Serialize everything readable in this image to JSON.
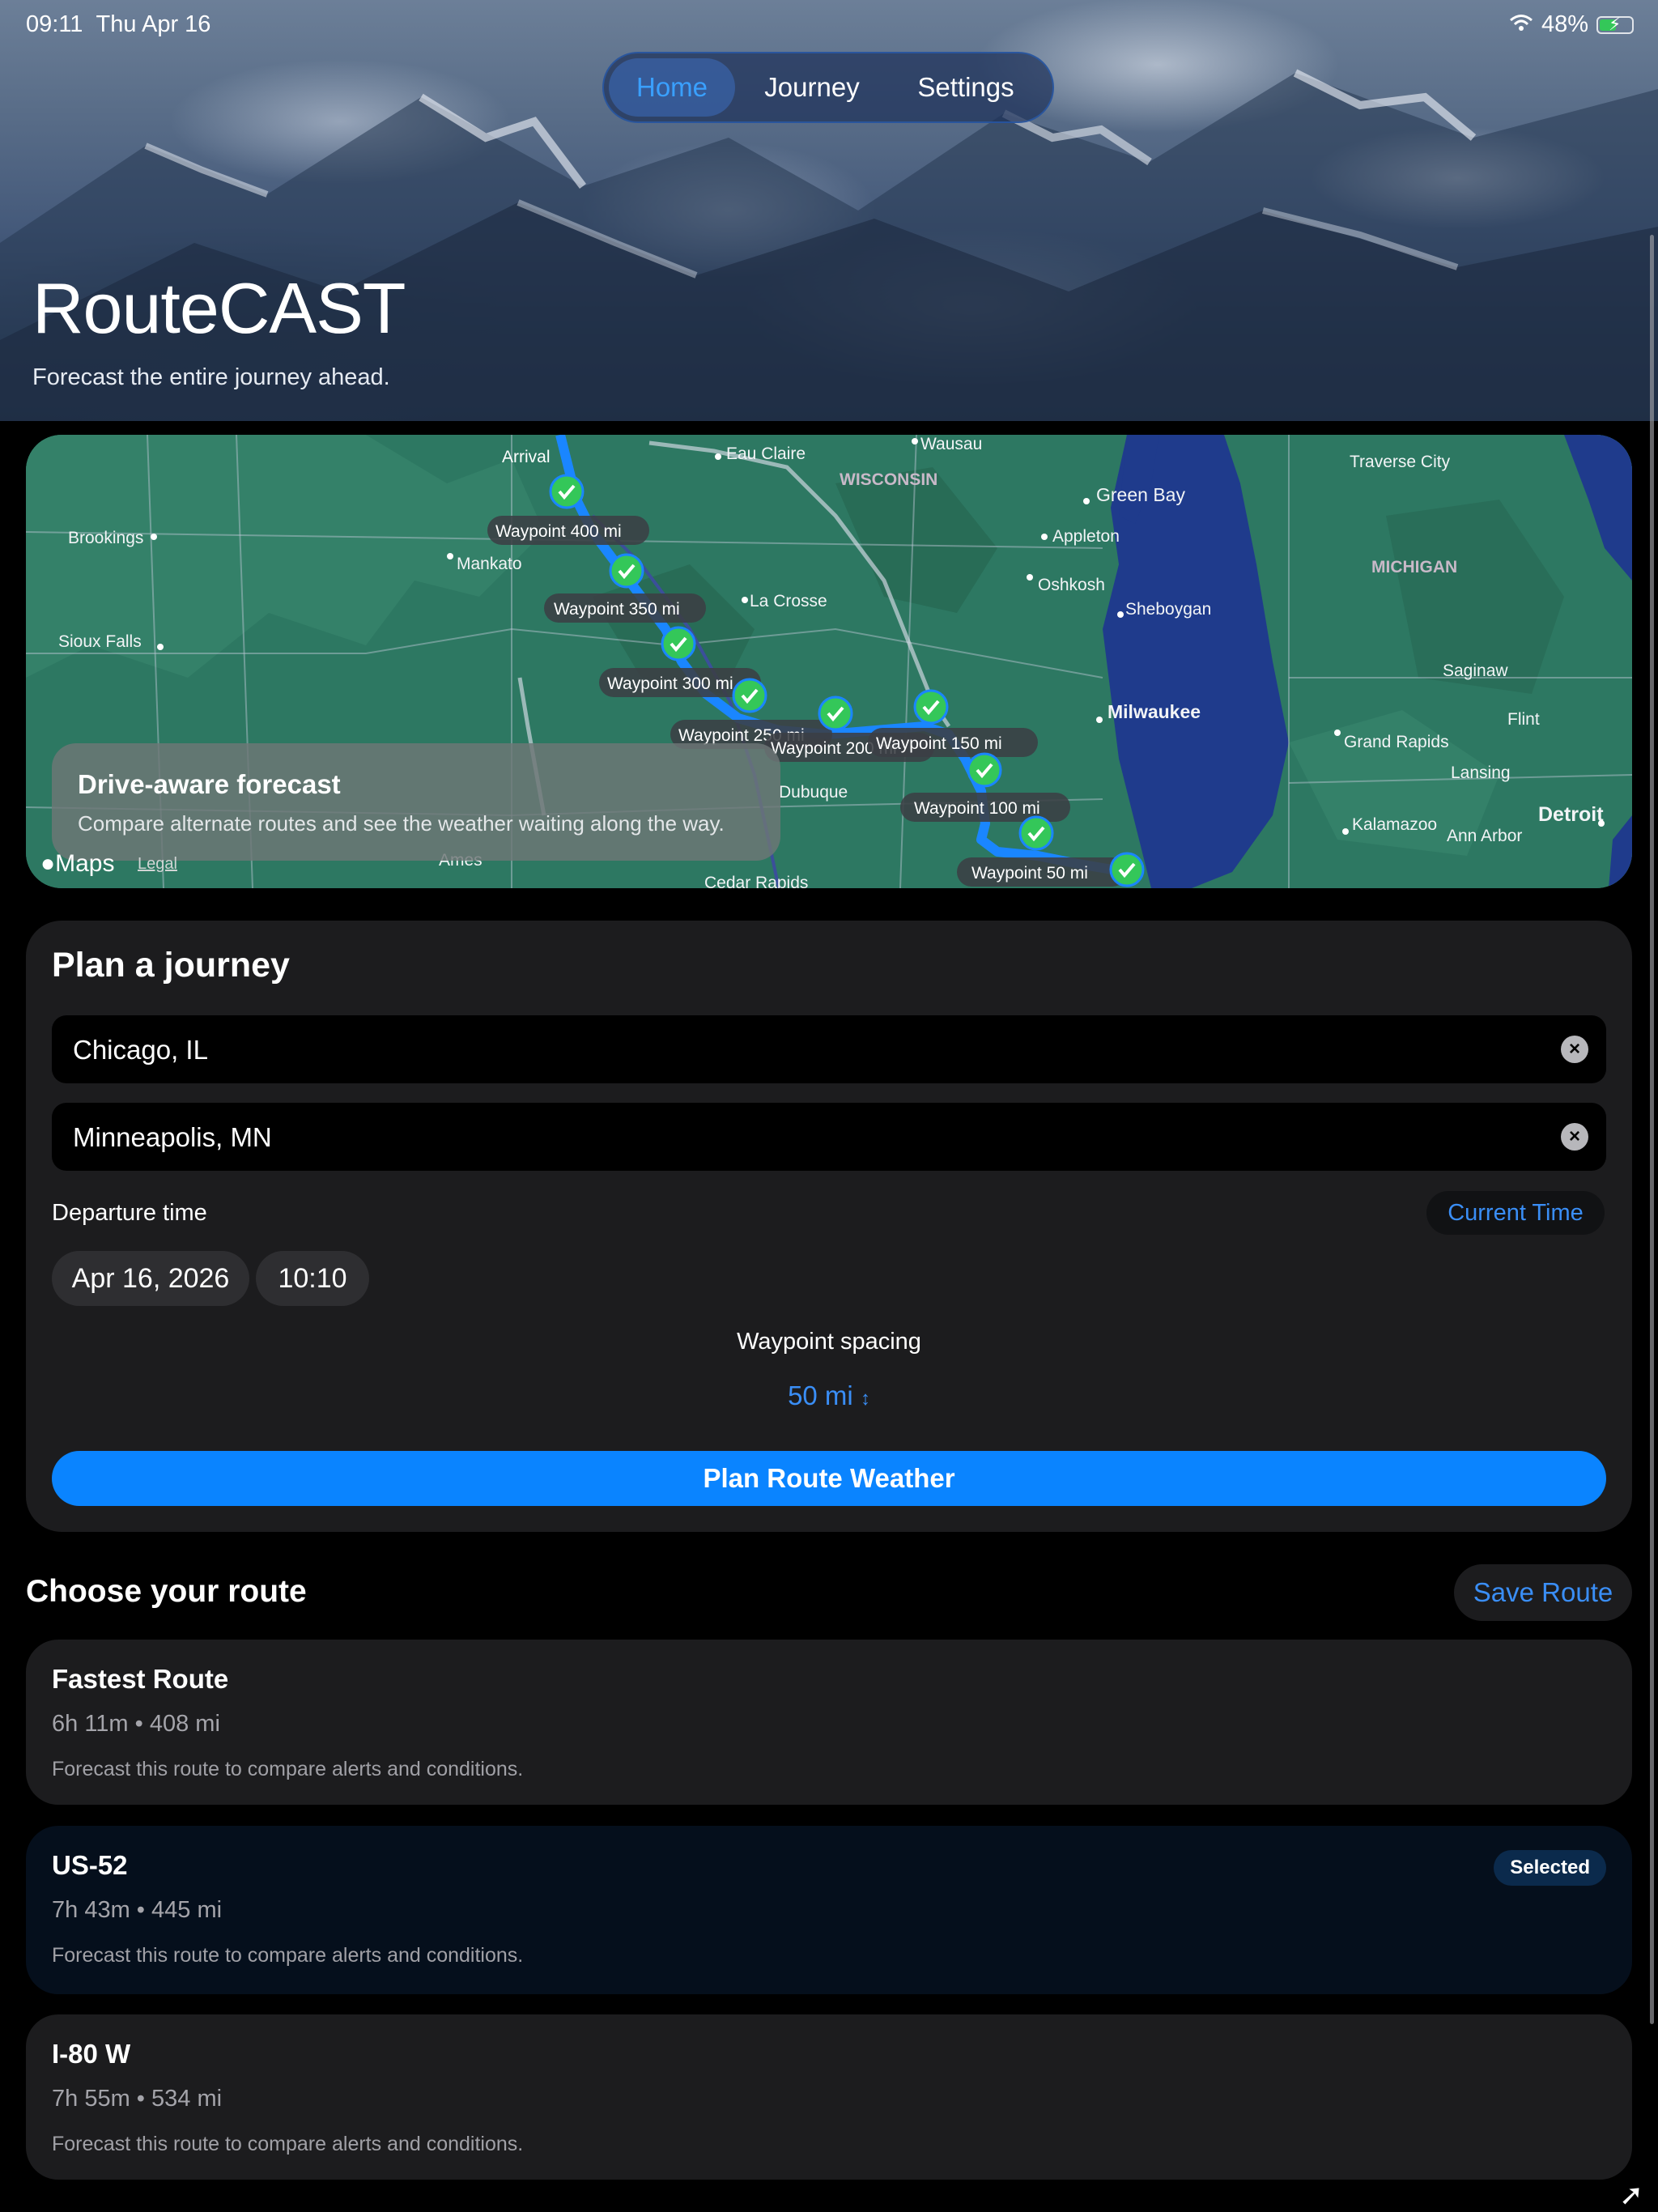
{
  "status_bar": {
    "time": "09:11",
    "date": "Thu Apr 16",
    "battery": "48%",
    "battery_level": 0.48
  },
  "nav": {
    "tabs": [
      {
        "label": "Home",
        "active": true
      },
      {
        "label": "Journey"
      },
      {
        "label": "Settings"
      }
    ]
  },
  "hero": {
    "title": "RouteCAST",
    "subtitle": "Forecast the entire journey ahead."
  },
  "map": {
    "cities": [
      "Eau Claire",
      "Wausau",
      "WISCONSIN",
      "Traverse City",
      "Green Bay",
      "Brookings",
      "Mankato",
      "Appleton",
      "Oshkosh",
      "MICHIGAN",
      "La Crosse",
      "Sheboygan",
      "Sioux Falls",
      "Saginaw",
      "Milwaukee",
      "Flint",
      "Grand Rapids",
      "Lansing",
      "Kalamazoo",
      "Ann Arbor",
      "Detroit",
      "Ames",
      "Cedar Rapids",
      "Dubuque"
    ],
    "waypoints": [
      "Arrival",
      "Waypoint 400 mi",
      "Waypoint 350 mi",
      "Waypoint 300 mi",
      "Waypoint 250 mi",
      "Waypoint 200 mi",
      "Waypoint 150 mi",
      "Waypoint 100 mi",
      "Waypoint 50 mi"
    ],
    "overlay": {
      "title": "Drive-aware forecast",
      "subtitle": "Compare alternate routes and see the weather waiting along the way."
    },
    "attribution": "Maps",
    "legal": "Legal"
  },
  "plan": {
    "title": "Plan a journey",
    "origin": "Chicago, IL",
    "destination": "Minneapolis, MN",
    "departure_label": "Departure time",
    "current_time_button": "Current Time",
    "date": "Apr 16, 2026",
    "time": "10:10",
    "spacing_label": "Waypoint spacing",
    "spacing_value": "50 mi",
    "submit": "Plan Route Weather"
  },
  "routes": {
    "title": "Choose your route",
    "save": "Save Route",
    "items": [
      {
        "name": "Fastest Route",
        "meta": "6h 11m • 408 mi",
        "note": "Forecast this route to compare alerts and conditions.",
        "selected": false
      },
      {
        "name": "US-52",
        "meta": "7h 43m • 445 mi",
        "note": "Forecast this route to compare alerts and conditions.",
        "selected": true,
        "badge": "Selected"
      },
      {
        "name": "I-80 W",
        "meta": "7h 55m • 534 mi",
        "note": "Forecast this route to compare alerts and conditions.",
        "selected": false
      }
    ]
  },
  "colors": {
    "accent": "#0a84ff",
    "link": "#3a8ef6",
    "waypoint_ok": "#34c759",
    "route": "#1a86ff",
    "lake": "#1f3b8c",
    "land": "#2d7862"
  }
}
